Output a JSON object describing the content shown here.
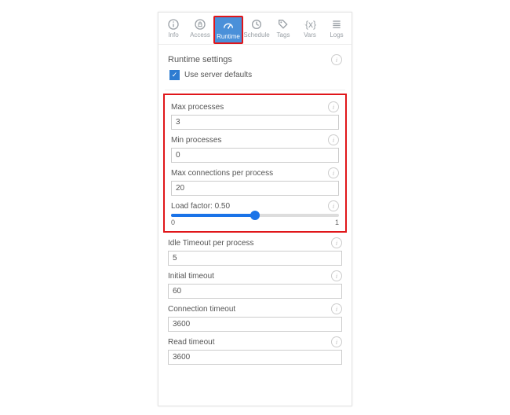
{
  "tabs": {
    "info": "Info",
    "access": "Access",
    "runtime": "Runtime",
    "schedule": "Schedule",
    "tags": "Tags",
    "vars": "Vars",
    "logs": "Logs"
  },
  "section_title": "Runtime settings",
  "checkbox_label": "Use server defaults",
  "fields": {
    "max_processes": {
      "label": "Max processes",
      "value": "3"
    },
    "min_processes": {
      "label": "Min processes",
      "value": "0"
    },
    "max_conn": {
      "label": "Max connections per process",
      "value": "20"
    },
    "load_factor": {
      "label": "Load factor: 0.50",
      "min": "0",
      "max": "1"
    },
    "idle_timeout": {
      "label": "Idle Timeout per process",
      "value": "5"
    },
    "initial_timeout": {
      "label": "Initial timeout",
      "value": "60"
    },
    "conn_timeout": {
      "label": "Connection timeout",
      "value": "3600"
    },
    "read_timeout": {
      "label": "Read timeout",
      "value": "3600"
    }
  }
}
